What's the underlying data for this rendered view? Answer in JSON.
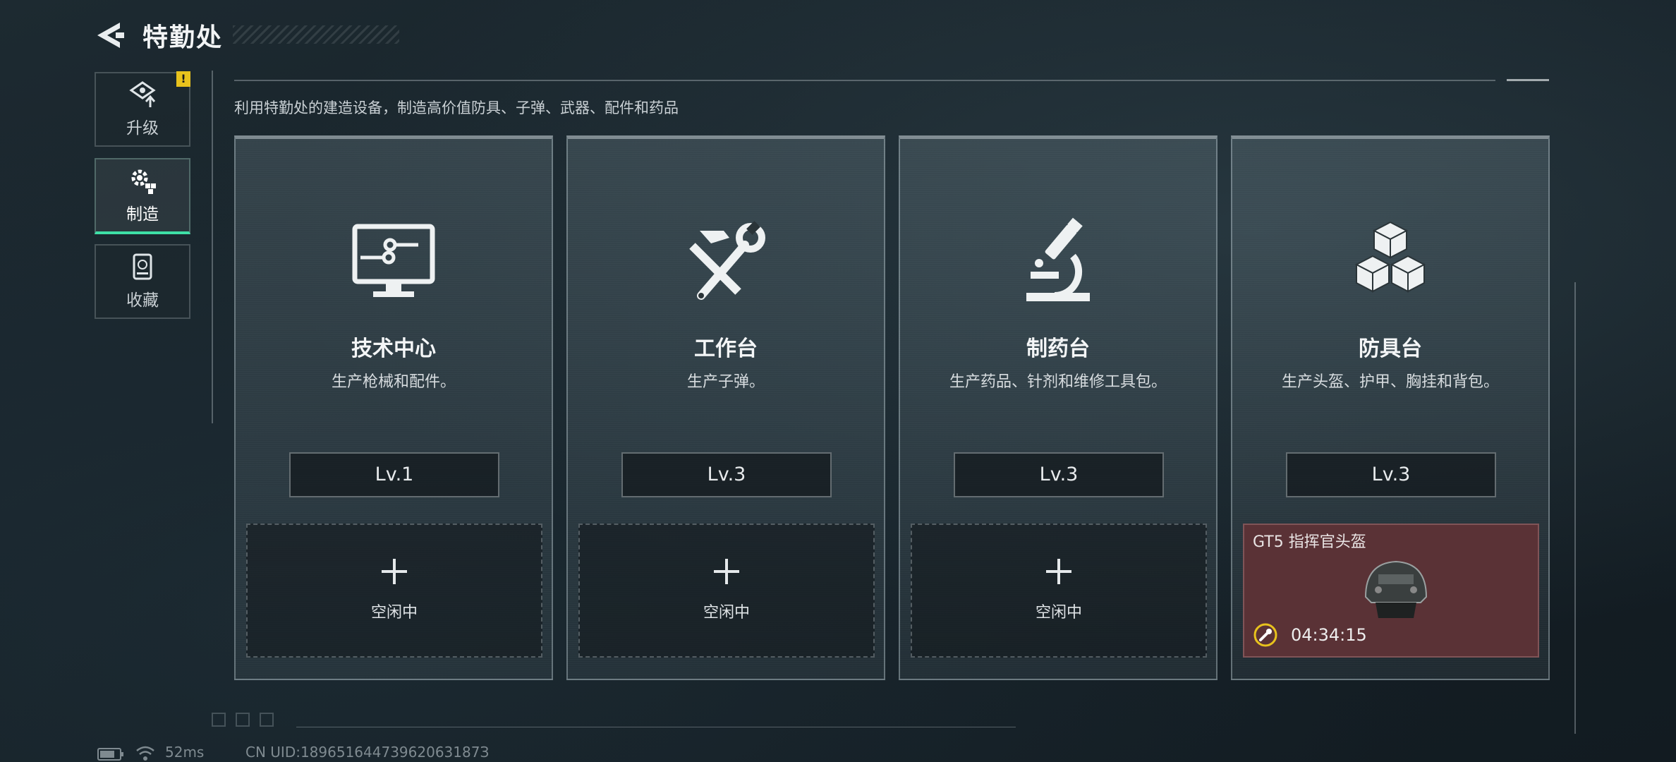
{
  "header": {
    "title": "特勤处"
  },
  "nav": {
    "items": [
      {
        "label": "升级",
        "icon": "upgrade-icon",
        "alert": "!"
      },
      {
        "label": "制造",
        "icon": "gear-craft-icon",
        "active": true
      },
      {
        "label": "收藏",
        "icon": "collection-icon"
      }
    ]
  },
  "description": "利用特勤处的建造设备，制造高价值防具、子弹、武器、配件和药品",
  "cards": [
    {
      "name": "技术中心",
      "subtitle": "生产枪械和配件。",
      "level": "Lv.1",
      "icon": "computer-icon",
      "slot": {
        "label": "空闲中"
      }
    },
    {
      "name": "工作台",
      "subtitle": "生产子弹。",
      "level": "Lv.3",
      "icon": "hammer-wrench-icon",
      "slot": {
        "label": "空闲中"
      }
    },
    {
      "name": "制药台",
      "subtitle": "生产药品、针剂和维修工具包。",
      "level": "Lv.3",
      "icon": "microscope-icon",
      "slot": {
        "label": "空闲中"
      }
    },
    {
      "name": "防具台",
      "subtitle": "生产头盔、护甲、胸挂和背包。",
      "level": "Lv.3",
      "icon": "cubes-icon",
      "job": {
        "item": "GT5 指挥官头盔",
        "timer": "04:34:15"
      }
    }
  ],
  "footer": {
    "ping": "52ms",
    "uid": "CN UID:18965164473962063187З"
  },
  "colors": {
    "accent": "#3ee0a6",
    "alert": "#e8c21d",
    "job_bg": "#5a3236",
    "timer_ring": "#e8c21d"
  }
}
